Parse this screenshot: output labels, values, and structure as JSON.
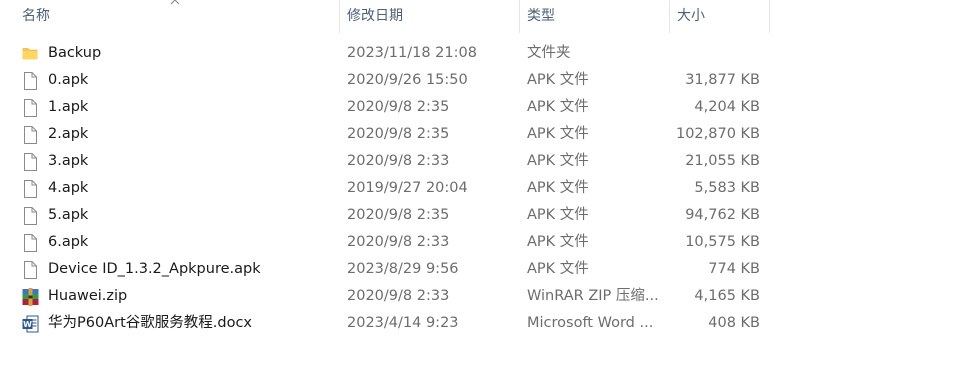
{
  "columns": {
    "name": "名称",
    "date": "修改日期",
    "type": "类型",
    "size": "大小"
  },
  "files": [
    {
      "icon": "folder-icon",
      "name": "Backup",
      "date": "2023/11/18 21:08",
      "type": "文件夹",
      "size": ""
    },
    {
      "icon": "file-icon",
      "name": "0.apk",
      "date": "2020/9/26 15:50",
      "type": "APK 文件",
      "size": "31,877 KB"
    },
    {
      "icon": "file-icon",
      "name": "1.apk",
      "date": "2020/9/8 2:35",
      "type": "APK 文件",
      "size": "4,204 KB"
    },
    {
      "icon": "file-icon",
      "name": "2.apk",
      "date": "2020/9/8 2:35",
      "type": "APK 文件",
      "size": "102,870 KB"
    },
    {
      "icon": "file-icon",
      "name": "3.apk",
      "date": "2020/9/8 2:33",
      "type": "APK 文件",
      "size": "21,055 KB"
    },
    {
      "icon": "file-icon",
      "name": "4.apk",
      "date": "2019/9/27 20:04",
      "type": "APK 文件",
      "size": "5,583 KB"
    },
    {
      "icon": "file-icon",
      "name": "5.apk",
      "date": "2020/9/8 2:35",
      "type": "APK 文件",
      "size": "94,762 KB"
    },
    {
      "icon": "file-icon",
      "name": "6.apk",
      "date": "2020/9/8 2:33",
      "type": "APK 文件",
      "size": "10,575 KB"
    },
    {
      "icon": "file-icon",
      "name": "Device ID_1.3.2_Apkpure.apk",
      "date": "2023/8/29 9:56",
      "type": "APK 文件",
      "size": "774 KB"
    },
    {
      "icon": "winrar-icon",
      "name": "Huawei.zip",
      "date": "2020/9/8 2:33",
      "type": "WinRAR ZIP 压缩...",
      "size": "4,165 KB"
    },
    {
      "icon": "word-document-icon",
      "name": "华为P60Art谷歌服务教程.docx",
      "date": "2023/4/14 9:23",
      "type": "Microsoft Word ...",
      "size": "408 KB"
    }
  ],
  "colors": {
    "header_text": "#4c607a",
    "secondary_text": "#6d6d6d",
    "folder": "#f7c948",
    "word_blue": "#2b5797"
  }
}
